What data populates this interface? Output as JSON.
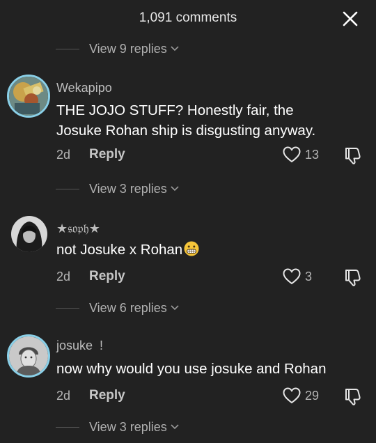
{
  "header": {
    "title": "1,091 comments"
  },
  "replies_top": {
    "label": "View 9 replies"
  },
  "comments": [
    {
      "username": "Wekapipo",
      "text_line1": "THE JOJO STUFF? Honestly fair, the",
      "text_line2": "Josuke Rohan ship is disgusting anyway.",
      "date": "2d",
      "reply_label": "Reply",
      "likes": "13",
      "view_replies": "View 3 replies"
    },
    {
      "username": "★𝔰𝔬𝔭𝔥★",
      "text": "not Josuke x Rohan",
      "emoji": "grimacing-face",
      "date": "2d",
      "reply_label": "Reply",
      "likes": "3",
      "view_replies": "View 6 replies"
    },
    {
      "username": "josuke  !",
      "text": "now why would you use josuke and Rohan",
      "date": "2d",
      "reply_label": "Reply",
      "likes": "29",
      "view_replies": "View 3 replies"
    }
  ],
  "colors": {
    "background": "#222222",
    "avatar_ring": "#8ad0e8",
    "muted_text": "#b5b5b5"
  }
}
